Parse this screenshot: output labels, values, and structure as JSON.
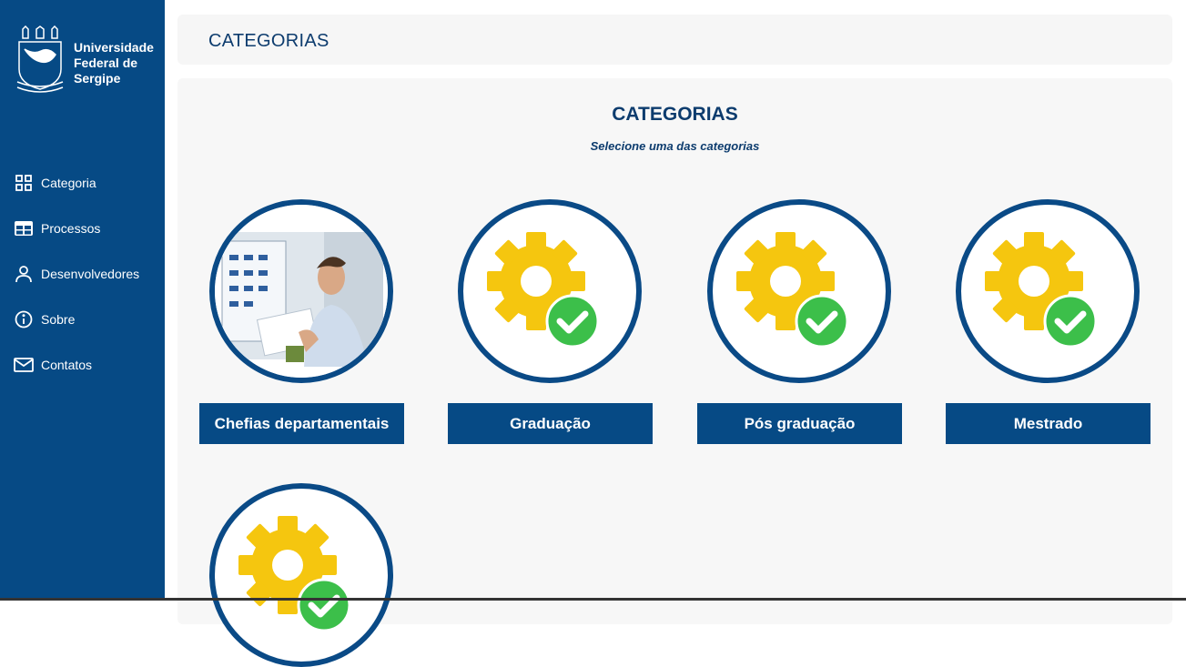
{
  "sidebar": {
    "logo": {
      "line1": "Universidade",
      "line2": "Federal de",
      "line3": "Sergipe"
    },
    "items": [
      {
        "label": "Categoria",
        "icon": "grid-icon"
      },
      {
        "label": "Processos",
        "icon": "table-icon"
      },
      {
        "label": "Desenvolvedores",
        "icon": "user-icon"
      },
      {
        "label": "Sobre",
        "icon": "info-icon"
      },
      {
        "label": "Contatos",
        "icon": "mail-icon"
      }
    ]
  },
  "header": {
    "title": "CATEGORIAS"
  },
  "content": {
    "title": "CATEGORIAS",
    "subtitle": "Selecione uma das categorias",
    "categories": [
      {
        "label": "Chefias departamentais",
        "image": "person-photo"
      },
      {
        "label": "Graduação",
        "image": "gear-check-icon"
      },
      {
        "label": "Pós graduação",
        "image": "gear-check-icon"
      },
      {
        "label": "Mestrado",
        "image": "gear-check-icon"
      },
      {
        "label": "",
        "image": "gear-check-icon"
      }
    ]
  },
  "colors": {
    "primary": "#064a85",
    "text_dark_blue": "#0d3c6e",
    "gear": "#f7c812",
    "check": "#3cbf4a",
    "card_bg": "#f7f7f7"
  }
}
